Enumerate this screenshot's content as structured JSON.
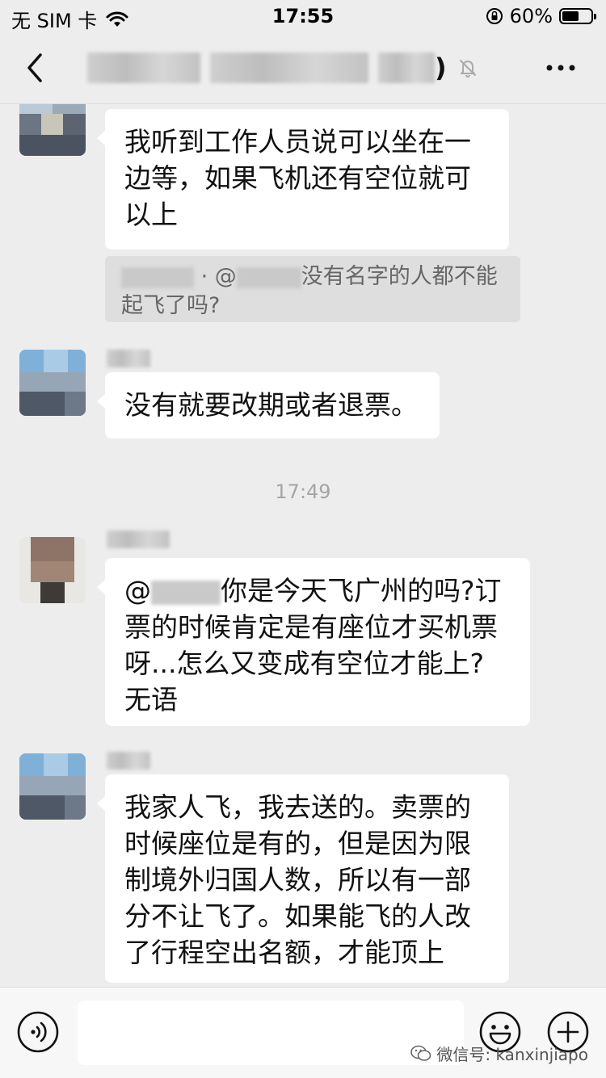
{
  "status_bar": {
    "carrier": "无 SIM 卡",
    "time": "17:55",
    "battery_percent": "60%",
    "battery_level": 0.6,
    "icons": [
      "wifi-icon",
      "orientation-lock-icon",
      "battery-icon"
    ]
  },
  "nav": {
    "back_icon": "chevron-left-icon",
    "title_suffix": ")",
    "mute_icon": "bell-muted-icon",
    "more_icon": "more-dots-icon"
  },
  "messages": [
    {
      "text": "我听到工作人员说可以坐在一边等，如果飞机还有空位就可以上"
    },
    {
      "quote_prefix": "·  @",
      "quote_text": "没有名字的人都不能起飞了吗?"
    },
    {
      "text": "没有就要改期或者退票。"
    },
    {
      "timestamp": "17:49"
    },
    {
      "prefix": "@",
      "text": "你是今天飞广州的吗?订票的时候肯定是有座位才买机票呀...怎么又变成有空位才能上? 无语"
    },
    {
      "text": "我家人飞，我去送的。卖票的时候座位是有的，但是因为限制境外归国人数，所以有一部分不让飞了。如果能飞的人改了行程空出名额，才能顶上"
    }
  ],
  "input_bar": {
    "voice_icon": "voice-icon",
    "emoji_icon": "emoji-icon",
    "plus_icon": "plus-icon",
    "placeholder": ""
  },
  "watermark": {
    "icon": "wechat-icon",
    "text": "微信号: kanxinjiapo"
  },
  "colors": {
    "background": "#ededed",
    "bubble": "#ffffff",
    "quote": "#dedede",
    "timestamp": "#a5a5a5"
  }
}
